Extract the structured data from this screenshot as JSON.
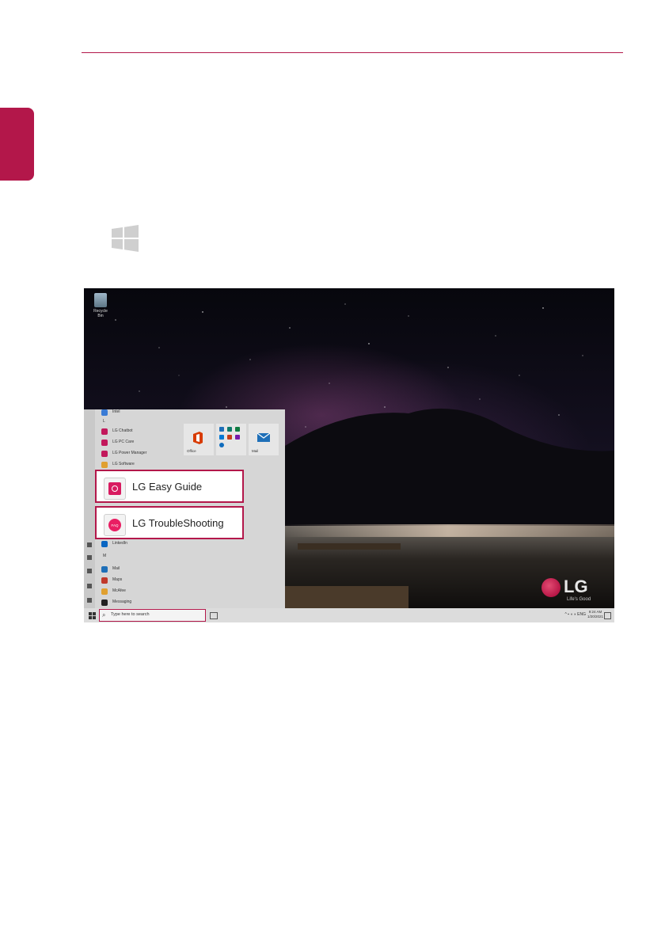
{
  "colors": {
    "accent": "#b3174a",
    "lg_red": "#a50034"
  },
  "desktop": {
    "recycle_bin_label": "Recycle Bin",
    "lg_logo_text": "LG",
    "lg_tagline": "Life's Good"
  },
  "start_menu": {
    "apps": [
      {
        "label": "Intel",
        "icon": "#3a7bd5"
      },
      {
        "label": "L",
        "icon": ""
      },
      {
        "label": "LG Chatbot",
        "icon": "#c2185b"
      },
      {
        "label": "LG PC Care",
        "icon": "#c2185b"
      },
      {
        "label": "LG Power Manager",
        "icon": "#c2185b"
      },
      {
        "label": "LG Software",
        "icon": "#e0a030"
      }
    ],
    "apps_lower": [
      {
        "label": "LinkedIn",
        "icon": "#0a66c2"
      },
      {
        "label": "M",
        "icon": ""
      },
      {
        "label": "Mail",
        "icon": "#1e6fb8"
      },
      {
        "label": "Maps",
        "icon": "#c0392b"
      },
      {
        "label": "McAfee",
        "icon": "#e0a030"
      },
      {
        "label": "Messaging",
        "icon": "#222222"
      }
    ],
    "tiles": {
      "office": "Office",
      "mail": "Mail"
    },
    "callouts": {
      "easy_guide": "LG Easy Guide",
      "troubleshooting": "LG TroubleShooting",
      "troubleshooting_icon_text": "FAQ"
    }
  },
  "taskbar": {
    "search_placeholder": "Type here to search",
    "tray_language": "ENG",
    "time": "9:24 AM",
    "date": "1/20/2021"
  }
}
